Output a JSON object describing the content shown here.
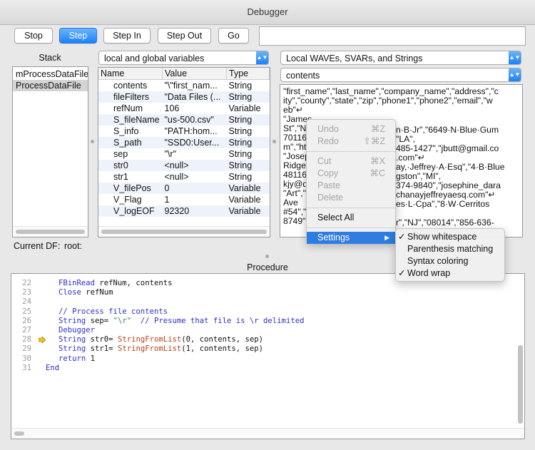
{
  "window": {
    "title": "Debugger"
  },
  "toolbar": {
    "stop": "Stop",
    "step": "Step",
    "step_in": "Step In",
    "step_out": "Step Out",
    "go": "Go",
    "command_value": ""
  },
  "stack": {
    "title": "Stack",
    "items": [
      {
        "label": "mProcessDataFile"
      },
      {
        "label": "ProcessDataFile"
      }
    ]
  },
  "variables": {
    "scope_selected": "local and global variables",
    "columns": {
      "name": "Name",
      "value": "Value",
      "type": "Type"
    },
    "rows": [
      {
        "name": "contents",
        "value": "\"\\\"first_nam...",
        "type": "String"
      },
      {
        "name": "fileFilters",
        "value": "\"Data Files (...",
        "type": "String"
      },
      {
        "name": "refNum",
        "value": "106",
        "type": "Variable"
      },
      {
        "name": "S_fileName",
        "value": "\"us-500.csv\"",
        "type": "String"
      },
      {
        "name": "S_info",
        "value": "\"PATH:hom...",
        "type": "String"
      },
      {
        "name": "S_path",
        "value": "\"SSD0:User...",
        "type": "String"
      },
      {
        "name": "sep",
        "value": "\"\\r\"",
        "type": "String"
      },
      {
        "name": "str0",
        "value": "<null>",
        "type": "String"
      },
      {
        "name": "str1",
        "value": "<null>",
        "type": "String"
      },
      {
        "name": "V_filePos",
        "value": "0",
        "type": "Variable"
      },
      {
        "name": "V_Flag",
        "value": "1",
        "type": "Variable"
      },
      {
        "name": "V_logEOF",
        "value": "92320",
        "type": "Variable"
      }
    ]
  },
  "inspector": {
    "kind_selected": "Local WAVEs, SVARs, and Strings",
    "item_selected": "contents",
    "text_lines": [
      "\"first_name\",\"last_name\",\"company_name\",\"address\",\"c",
      "ity\",\"county\",\"state\",\"zip\",\"phone1\",\"phone2\",\"email\",\"w",
      "eb\"↵",
      "\"James",
      "St\",\"N",
      "70116",
      "m\",\"ht",
      "\"Josep",
      "Ridge",
      "48116",
      "kjy@da",
      "\"Art\",\"",
      "Ave",
      "#54\",\"",
      "8749\""
    ],
    "right_fragments": [
      "n·B·Jr\",\"6649·N·Blue·Gum",
      "\"LA\",",
      "485-1427\",\"jbutt@gmail.co",
      ".com\"↵",
      "ay,·Jeffrey·A·Esq\",\"4·B·Blue",
      "gston\",\"MI\",",
      "374-9840\",\"josephine_dara",
      "chanayjeffreyaesq.com\"↵",
      "es·L·Cpa\",\"8·W·Cerritos",
      "r\",\"NJ\",\"08014\",\"856-636-"
    ]
  },
  "current_df": {
    "label": "Current DF:",
    "value": "root:"
  },
  "procedure": {
    "title": "Procedure",
    "lines": [
      {
        "num": "22",
        "text": "FBinRead refNum, contents"
      },
      {
        "num": "23",
        "text": "Close refNum"
      },
      {
        "num": "24",
        "text": ""
      },
      {
        "num": "25",
        "text": "// Process file contents"
      },
      {
        "num": "26",
        "text": "String sep= \"\\r\"  // Presume that file is \\r delimited"
      },
      {
        "num": "27",
        "text": "Debugger"
      },
      {
        "num": "28",
        "text": "String str0= StringFromList(0, contents, sep)"
      },
      {
        "num": "29",
        "text": "String str1= StringFromList(1, contents, sep)"
      },
      {
        "num": "30",
        "text": "return 1"
      },
      {
        "num": "31",
        "text": "End"
      }
    ],
    "current_line": "28"
  },
  "context_menu": {
    "undo": "Undo",
    "undo_sc": "⌘Z",
    "redo": "Redo",
    "redo_sc": "⇧⌘Z",
    "cut": "Cut",
    "cut_sc": "⌘X",
    "copy": "Copy",
    "copy_sc": "⌘C",
    "paste": "Paste",
    "delete": "Delete",
    "select_all": "Select All",
    "settings": "Settings"
  },
  "settings_menu": {
    "items": [
      {
        "label": "Show whitespace",
        "checked": "✓"
      },
      {
        "label": "Parenthesis matching",
        "checked": ""
      },
      {
        "label": "Syntax coloring",
        "checked": ""
      },
      {
        "label": "Word wrap",
        "checked": "✓"
      }
    ]
  },
  "colors": {
    "accent": "#1a82fb",
    "menu_highlight": "#2f7de1",
    "keyword": "#2d30c8",
    "string": "#2e8b57",
    "function": "#b5421c"
  }
}
